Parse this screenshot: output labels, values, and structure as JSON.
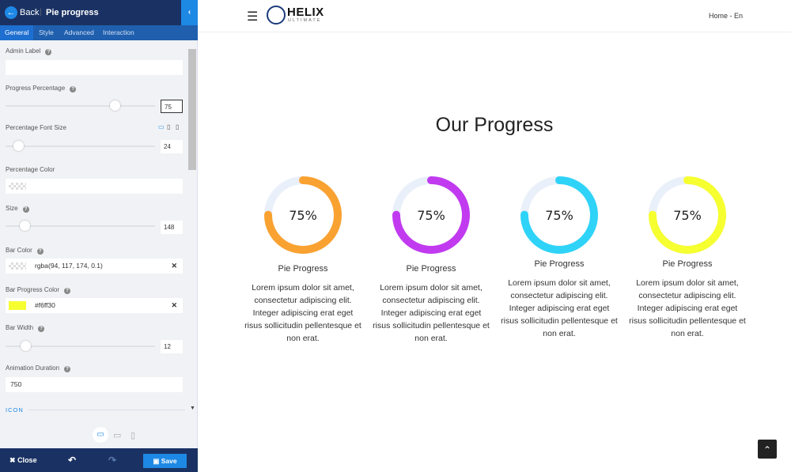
{
  "sidebar": {
    "back_label": "Back",
    "title": "Pie progress",
    "tabs": [
      "General",
      "Style",
      "Advanced",
      "Interaction"
    ],
    "admin_label": {
      "label": "Admin Label",
      "value": ""
    },
    "progress_percentage": {
      "label": "Progress Percentage",
      "value": "75",
      "slider_fraction": 0.75
    },
    "percentage_font_size": {
      "label": "Percentage Font Size",
      "value": "24"
    },
    "percentage_color": {
      "label": "Percentage Color",
      "value": ""
    },
    "size": {
      "label": "Size",
      "value": "148"
    },
    "bar_color": {
      "label": "Bar Color",
      "value": "rgba(94, 117, 174, 0.1)"
    },
    "bar_progress_color": {
      "label": "Bar Progress Color",
      "value": "#f6ff30",
      "swatch": "#f6ff30"
    },
    "bar_width": {
      "label": "Bar Width",
      "value": "12"
    },
    "animation_duration": {
      "label": "Animation Duration",
      "value": "750"
    },
    "icon_section": "ICON",
    "footer": {
      "close": "Close",
      "save": "Save"
    }
  },
  "header": {
    "logo_text": "HELIX",
    "logo_sub": "ULTIMATE",
    "breadcrumb": "Home - En"
  },
  "main": {
    "heading": "Our Progress",
    "cards": [
      {
        "percent": 75,
        "label": "75%",
        "title": "Pie Progress",
        "color": "#f9a231",
        "desc": "Lorem ipsum dolor sit amet, consectetur adipiscing elit. Integer adipiscing erat eget risus sollicitudin pellentesque et non erat."
      },
      {
        "percent": 75,
        "label": "75%",
        "title": "Pie Progress",
        "color": "#c13af0",
        "desc": "Lorem ipsum dolor sit amet, consectetur adipiscing elit. Integer adipiscing erat eget risus sollicitudin pellentesque et non erat."
      },
      {
        "percent": 75,
        "label": "75%",
        "title": "Pie Progress",
        "color": "#2fd3f7",
        "desc": "Lorem ipsum dolor sit amet, consectetur adipiscing elit. Integer adipiscing erat eget risus sollicitudin pellentesque et non erat."
      },
      {
        "percent": 75,
        "label": "75%",
        "title": "Pie Progress",
        "color": "#f6ff30",
        "desc": "Lorem ipsum dolor sit amet, consectetur adipiscing elit. Integer adipiscing erat eget risus sollicitudin pellentesque et non erat."
      }
    ]
  },
  "colors": {
    "sidebar_header": "#1a3263",
    "accent": "#1e88e5",
    "track": "#eaf0fa"
  }
}
